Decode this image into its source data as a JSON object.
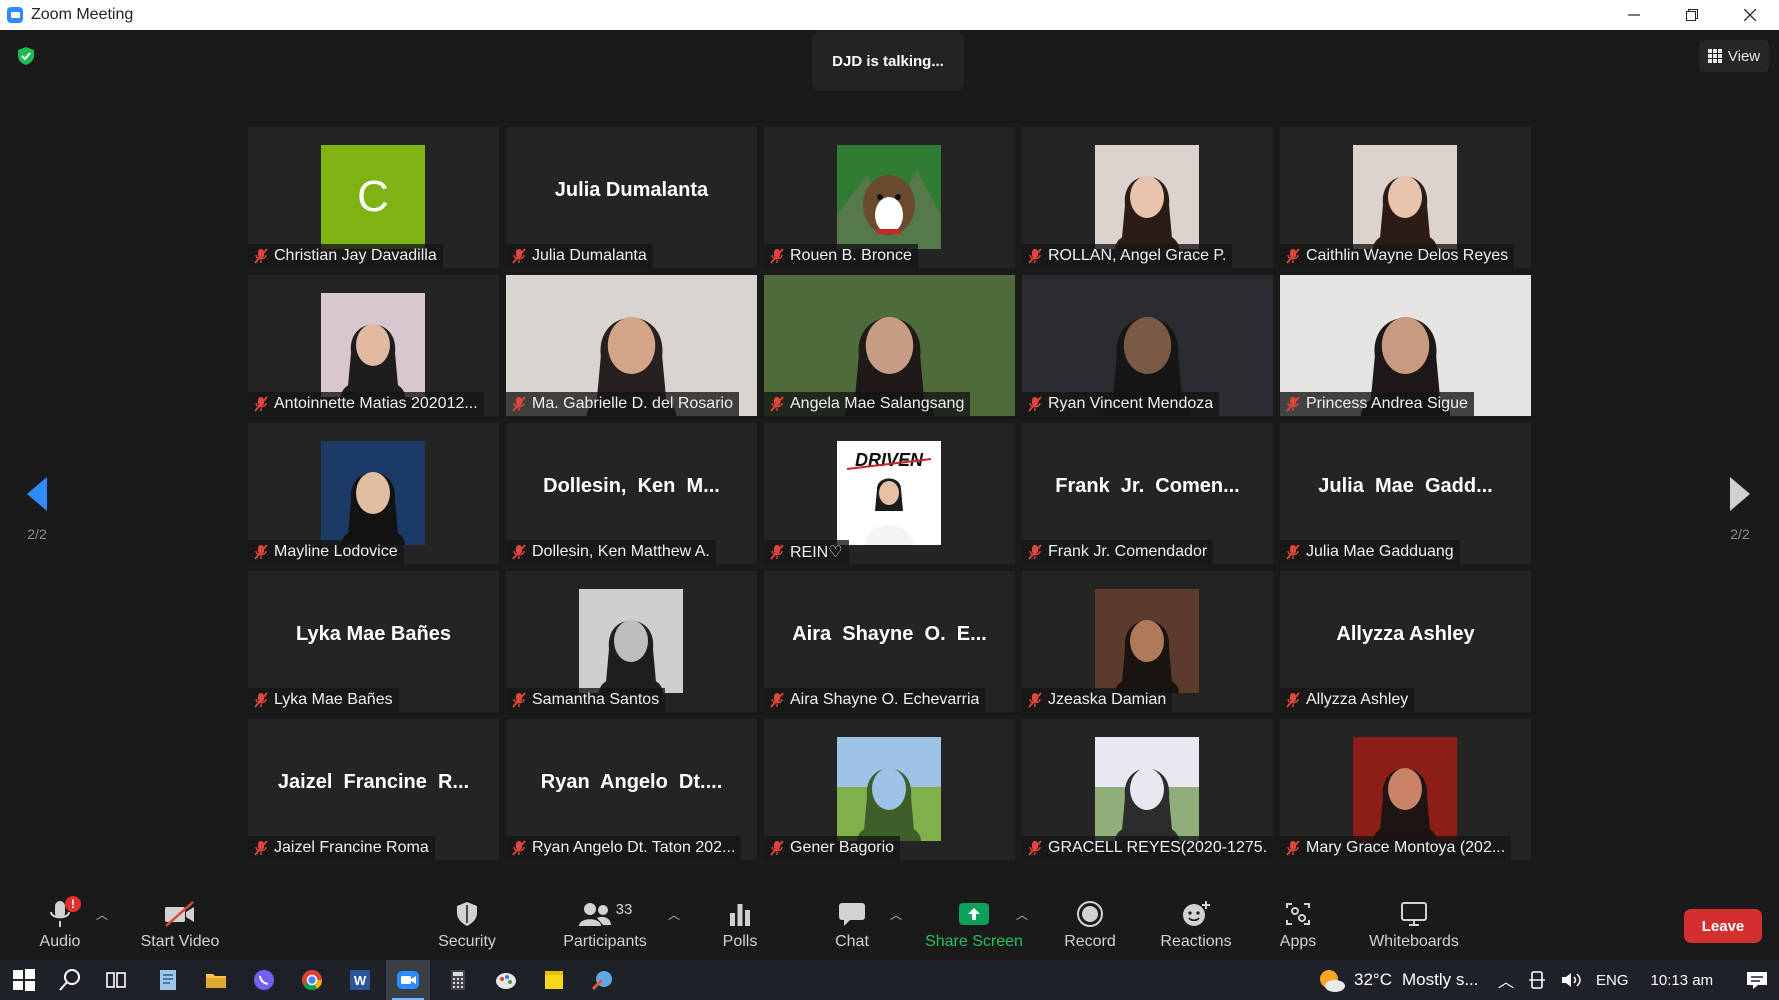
{
  "window": {
    "title": "Zoom Meeting"
  },
  "banner": {
    "talking": "DJD is talking..."
  },
  "view_button": {
    "label": "View"
  },
  "pagination": {
    "left": "2/2",
    "right": "2/2"
  },
  "tiles": [
    {
      "name": "Christian Jay Davadilla",
      "kind": "avatar",
      "avatar_letter": "C",
      "avatar_color": "#7fb314"
    },
    {
      "name": "Julia Dumalanta",
      "kind": "text",
      "display": "Julia Dumalanta"
    },
    {
      "name": "Rouen B. Bronce",
      "kind": "photo",
      "photo": "dog"
    },
    {
      "name": "ROLLAN, Angel Grace P.",
      "kind": "photo",
      "photo": "portrait-light"
    },
    {
      "name": "Caithlin Wayne Delos Reyes",
      "kind": "photo",
      "photo": "portrait-light"
    },
    {
      "name": "Antoinnette Matias 202012...",
      "kind": "photo",
      "photo": "portrait-dark"
    },
    {
      "name": "Ma. Gabrielle D. del Rosario",
      "kind": "video",
      "photo": "room-wall"
    },
    {
      "name": "Angela Mae Salangsang",
      "kind": "video",
      "photo": "blurred-green"
    },
    {
      "name": "Ryan Vincent Mendoza",
      "kind": "video",
      "photo": "dark-room"
    },
    {
      "name": "Princess Andrea Sigue",
      "kind": "video",
      "photo": "bright-room"
    },
    {
      "name": "Mayline Lodovice",
      "kind": "photo",
      "photo": "portrait-blue"
    },
    {
      "name": "Dollesin, Ken Matthew A.",
      "kind": "text",
      "display": "Dollesin,  Ken  M..."
    },
    {
      "name": "REIN♡",
      "kind": "photo",
      "photo": "driven-logo",
      "logo_text": "DRIVEN"
    },
    {
      "name": "Frank Jr. Comendador",
      "kind": "text",
      "display": "Frank  Jr.  Comen..."
    },
    {
      "name": "Julia Mae Gadduang",
      "kind": "text",
      "display": "Julia  Mae  Gadd..."
    },
    {
      "name": "Lyka Mae Bañes",
      "kind": "text",
      "display": "Lyka Mae Bañes"
    },
    {
      "name": "Samantha Santos",
      "kind": "photo",
      "photo": "portrait-bw"
    },
    {
      "name": "Aira Shayne O. Echevarria",
      "kind": "text",
      "display": "Aira  Shayne  O.  E..."
    },
    {
      "name": "Jzeaska Damian",
      "kind": "photo",
      "photo": "portrait-warm"
    },
    {
      "name": "Allyzza Ashley",
      "kind": "text",
      "display": "Allyzza Ashley"
    },
    {
      "name": "Jaizel Francine Roma",
      "kind": "text",
      "display": "Jaizel  Francine  R..."
    },
    {
      "name": "Ryan Angelo Dt. Taton 202...",
      "kind": "text",
      "display": "Ryan  Angelo  Dt...."
    },
    {
      "name": "Gener Bagorio",
      "kind": "photo",
      "photo": "outdoor"
    },
    {
      "name": "GRACELL REYES(2020-1275...",
      "kind": "photo",
      "photo": "outdoor-girl"
    },
    {
      "name": "Mary Grace Montoya (202...",
      "kind": "photo",
      "photo": "portrait-red"
    }
  ],
  "toolbar": {
    "audio": "Audio",
    "start_video": "Start Video",
    "security": "Security",
    "participants": "Participants",
    "participants_count": "33",
    "polls": "Polls",
    "chat": "Chat",
    "share_screen": "Share Screen",
    "record": "Record",
    "reactions": "Reactions",
    "apps": "Apps",
    "whiteboards": "Whiteboards",
    "leave": "Leave",
    "audio_badge": "!"
  },
  "taskbar": {
    "weather": "32°C",
    "weather_text": "Mostly s...",
    "language": "ENG",
    "time": "10:13 am"
  },
  "colors": {
    "accent_blue": "#2d8cff",
    "share_green": "#0e9f5a",
    "leave_red": "#d32f2f",
    "mute_red": "#e0463a"
  }
}
